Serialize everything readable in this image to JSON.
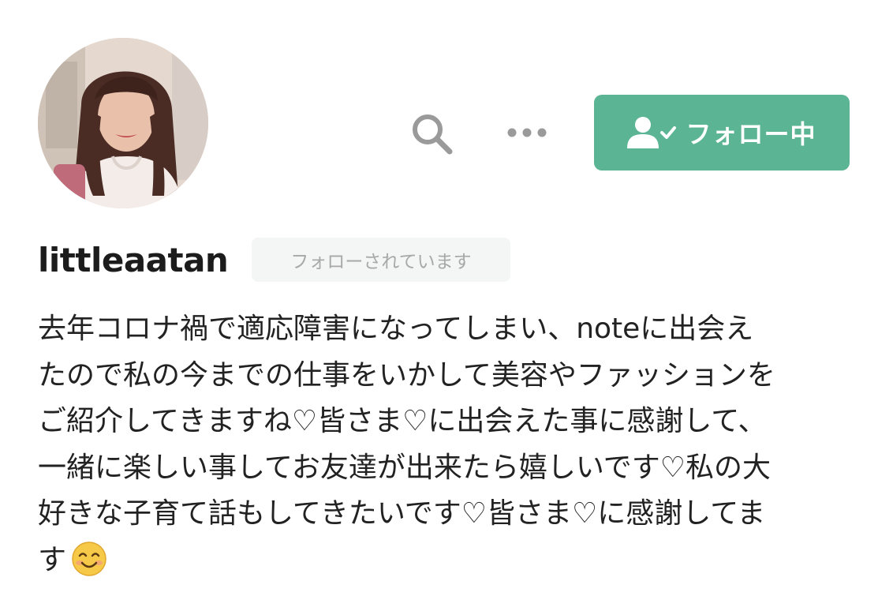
{
  "profile": {
    "avatar_alt": "profile photo",
    "username": "littleaatan",
    "follows_you_badge": "フォローされています"
  },
  "toolbar": {
    "search_icon": "search-icon",
    "more_icon": "more-horizontal-icon",
    "follow_button_label": "フォロー中",
    "follow_button_icon": "user-check-icon"
  },
  "bio": {
    "lines": [
      "去年コロナ禍で適応障害になってしまい、noteに出会え",
      "たので私の今までの仕事をいかして美容やファッションを",
      "ご紹介してきますね♡皆さま♡に出会えた事に感謝して、",
      "一緒に楽しい事してお友達が出来たら嬉しいです♡私の大",
      "好きな子育て話もしてきたいです♡皆さま♡に感謝してま",
      "す"
    ],
    "trailing_emoji": "smiling-face-emoji"
  },
  "colors": {
    "accent": "#5bb595",
    "icon_gray": "#9a9a9a",
    "badge_bg": "#f4f5f5",
    "badge_text": "#a8a8a8",
    "text": "#222222"
  }
}
